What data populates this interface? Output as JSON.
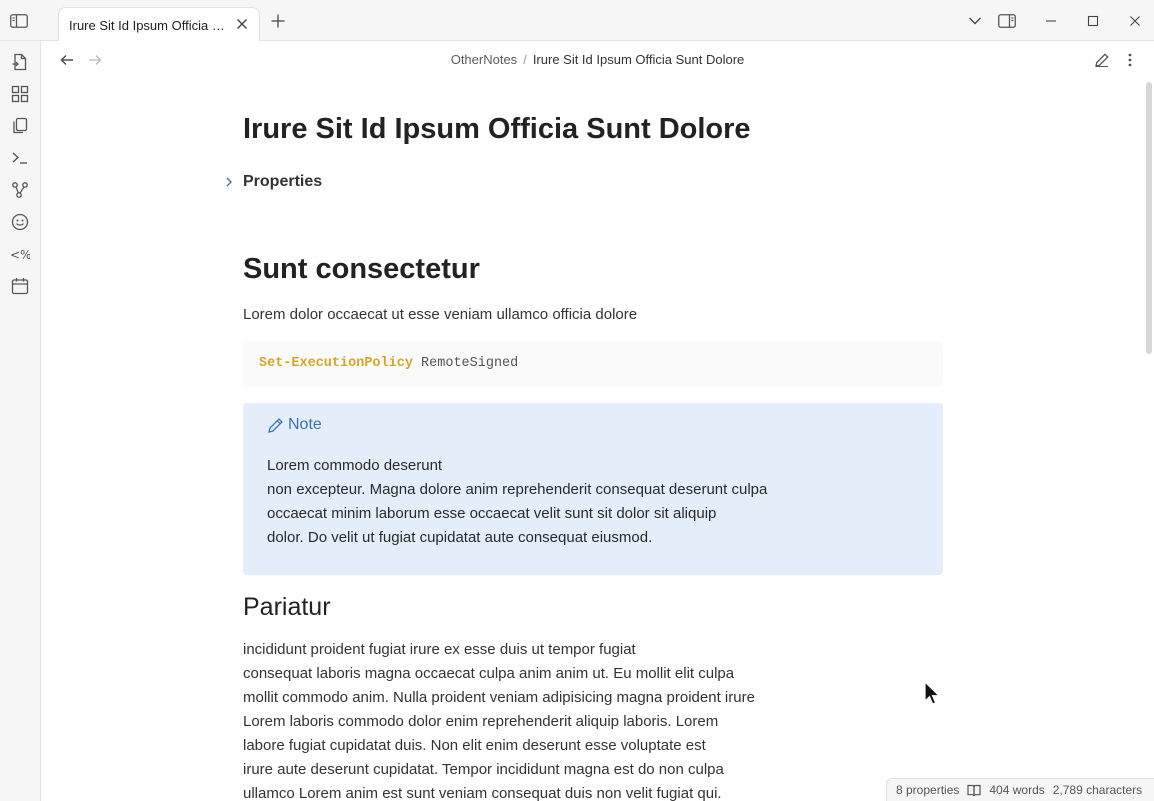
{
  "app": {
    "tab_title": "Irure Sit Id Ipsum Officia Sunt Dolore"
  },
  "breadcrumb": {
    "folder": "OtherNotes",
    "separator": "/",
    "current": "Irure Sit Id Ipsum Officia Sunt Dolore"
  },
  "note": {
    "title": "Irure Sit Id Ipsum Officia Sunt Dolore",
    "properties_label": "Properties",
    "heading1": "Sunt consectetur",
    "paragraph1": "Lorem dolor occaecat ut esse veniam ullamco officia dolore",
    "code": {
      "keyword": "Set-ExecutionPolicy",
      "argument": "RemoteSigned"
    },
    "callout": {
      "title": "Note",
      "lines": [
        "Lorem commodo deserunt",
        "non excepteur. Magna dolore anim reprehenderit consequat deserunt culpa",
        "occaecat minim laborum esse occaecat velit sunt sit dolor sit aliquip",
        "dolor. Do velit ut fugiat cupidatat aute consequat eiusmod."
      ]
    },
    "heading2": "Pariatur",
    "paragraph2_lines": [
      "incididunt proident fugiat irure ex esse duis ut tempor fugiat",
      "consequat laboris magna occaecat culpa anim anim ut. Eu mollit elit culpa",
      "mollit commodo anim. Nulla proident veniam adipisicing magna proident irure",
      "Lorem laboris commodo dolor enim reprehenderit aliquip laboris. Lorem",
      "labore fugiat cupidatat duis. Non elit enim deserunt esse voluptate est",
      "irure aute deserunt cupidatat. Tempor incididunt magna est do non culpa",
      "ullamco Lorem anim est sunt veniam consequat duis non velit fugiat qui."
    ]
  },
  "statusbar": {
    "properties": "8 properties",
    "words": "404 words",
    "characters": "2,789 characters"
  },
  "icons": {
    "ribbon": [
      "open-file-icon",
      "grid-icon",
      "copy-icon",
      "terminal-icon",
      "graph-icon",
      "smiley-icon",
      "template-icon",
      "calendar-icon"
    ],
    "accent_color": "#3f74a6",
    "callout_bg": "#e3eefa",
    "code_keyword_color": "#d8a528"
  }
}
